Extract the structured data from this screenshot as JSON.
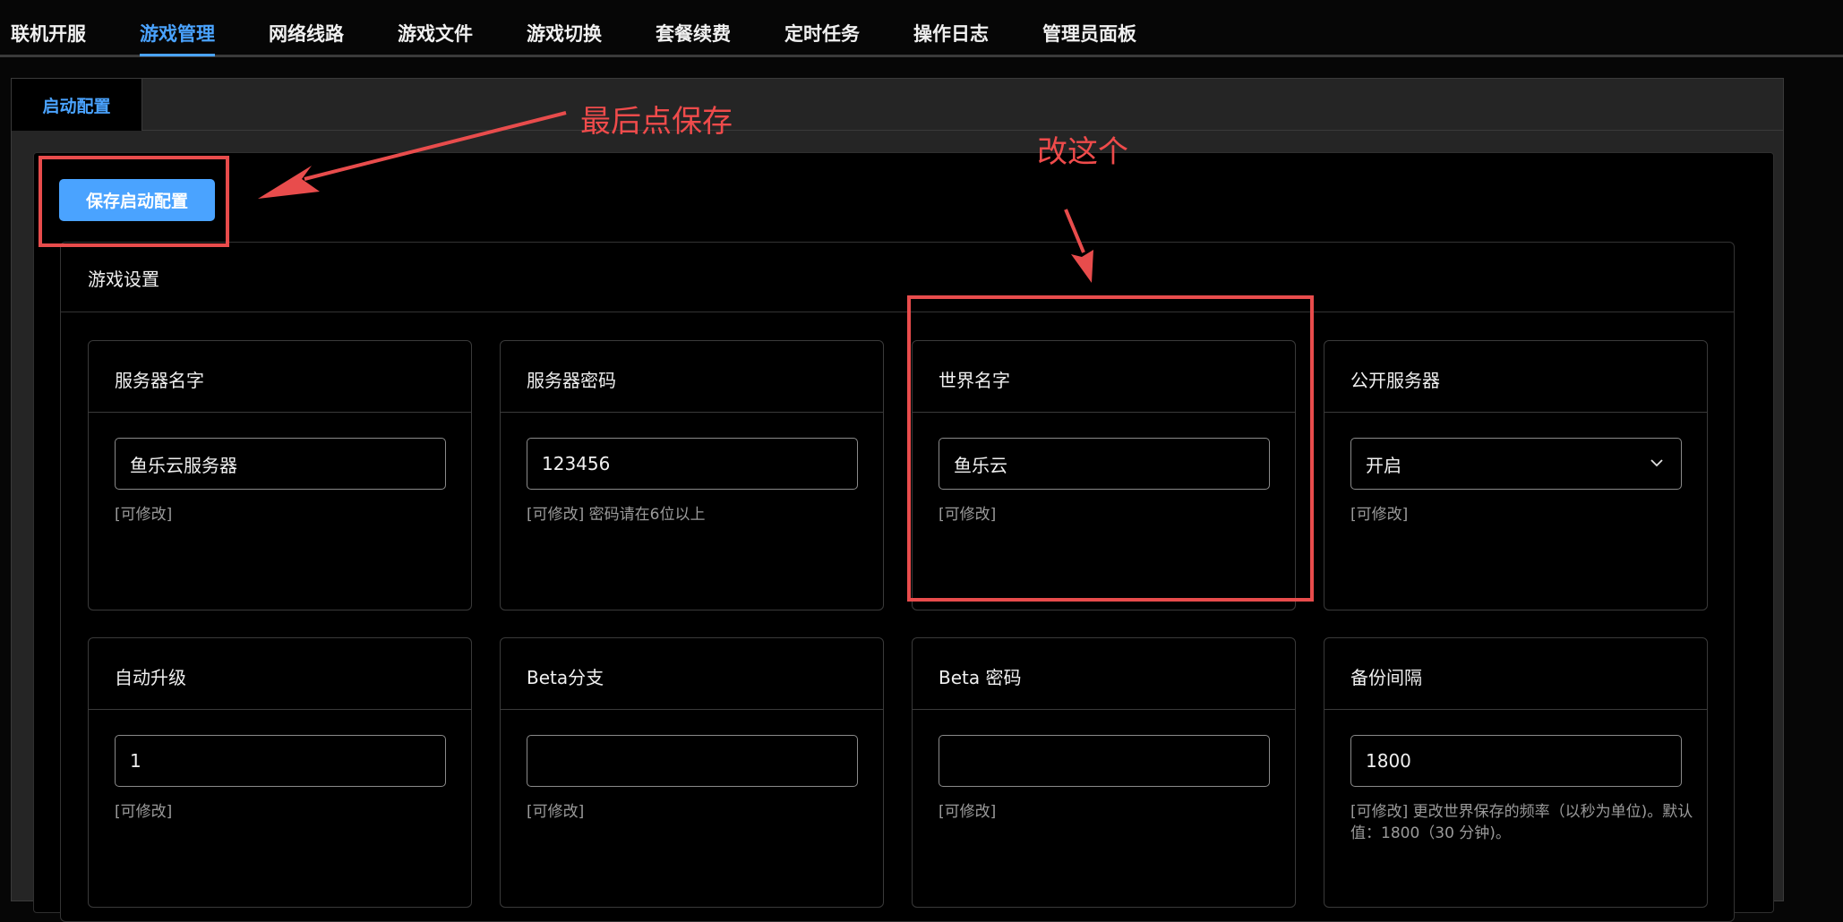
{
  "nav": {
    "tabs": [
      {
        "label": "联机开服"
      },
      {
        "label": "游戏管理",
        "active": true
      },
      {
        "label": "网络线路"
      },
      {
        "label": "游戏文件"
      },
      {
        "label": "游戏切换"
      },
      {
        "label": "套餐续费"
      },
      {
        "label": "定时任务"
      },
      {
        "label": "操作日志"
      },
      {
        "label": "管理员面板"
      }
    ]
  },
  "subtab": {
    "label": "启动配置"
  },
  "toolbar": {
    "save_label": "保存启动配置"
  },
  "game_settings": {
    "title": "游戏设置",
    "fields": [
      {
        "label": "服务器名字",
        "value": "鱼乐云服务器",
        "help": "[可修改]"
      },
      {
        "label": "服务器密码",
        "value": "123456",
        "help": "[可修改] 密码请在6位以上"
      },
      {
        "label": "世界名字",
        "value": "鱼乐云",
        "help": "[可修改]"
      },
      {
        "label": "公开服务器",
        "value": "开启",
        "help": "[可修改]"
      },
      {
        "label": "自动升级",
        "value": "1",
        "help": "[可修改]"
      },
      {
        "label": "Beta分支",
        "value": "",
        "help": "[可修改]"
      },
      {
        "label": "Beta 密码",
        "value": "",
        "help": "[可修改]"
      },
      {
        "label": "备份间隔",
        "value": "1800",
        "help": "[可修改] 更改世界保存的频率（以秒为单位)。默认值：1800（30 分钟)。"
      }
    ]
  },
  "annotations": {
    "save_hint": "最后点保存",
    "change_hint": "改这个",
    "color": "#e84c4c"
  },
  "colors": {
    "accent": "#4aa3ff",
    "background": "#000000",
    "panel": "#252525"
  }
}
